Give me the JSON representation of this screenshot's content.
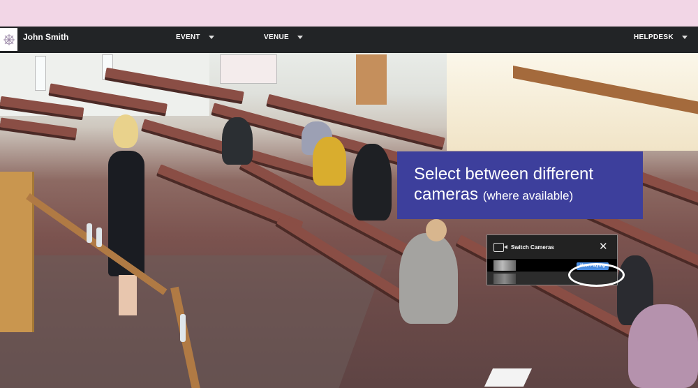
{
  "header": {
    "user_name": "John Smith",
    "menu": [
      {
        "label": "EVENT"
      },
      {
        "label": "VENUE"
      },
      {
        "label": "HELPDESK"
      }
    ]
  },
  "overlay": {
    "title": "Select between different",
    "title_line2": "cameras",
    "subtitle": "(where available)"
  },
  "camera_panel": {
    "title": "Switch Cameras",
    "close": "✕",
    "now_playing": "Now Playing"
  },
  "colors": {
    "navbar": "#222426",
    "top_band": "#f2d6e6",
    "callout": "#3d3f9c",
    "now_playing": "#4a8de0"
  },
  "icons": [
    "logo-icon",
    "chevron-down-icon",
    "video-camera-icon",
    "close-icon"
  ]
}
